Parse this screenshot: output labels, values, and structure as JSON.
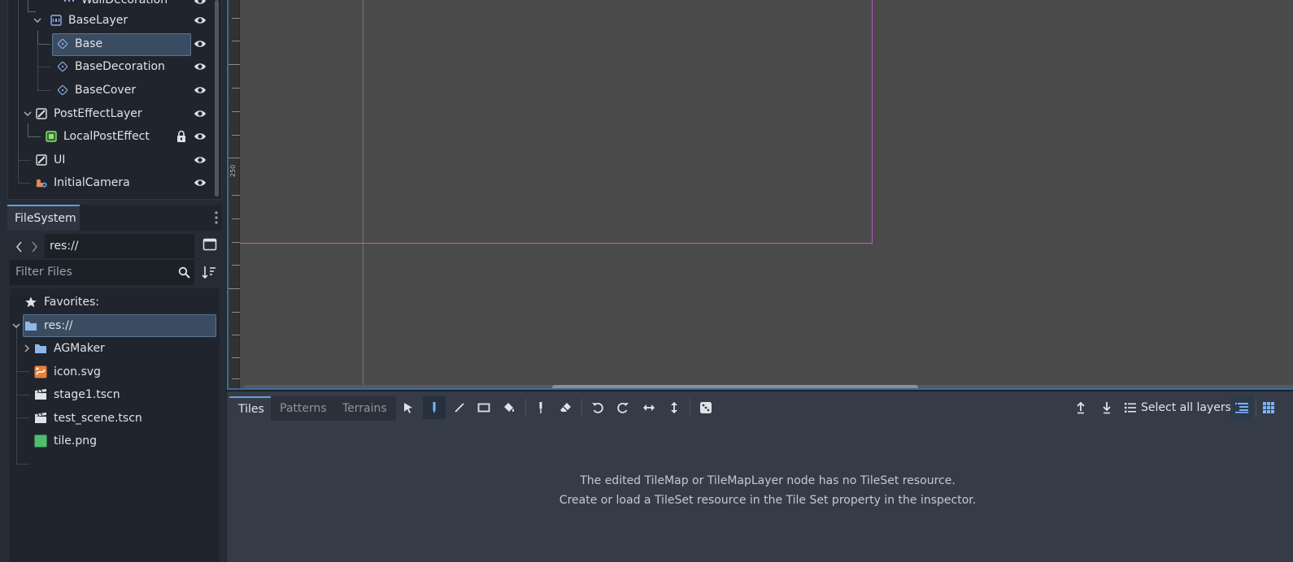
{
  "scene_tree": {
    "items": [
      {
        "label": "WallDecoration",
        "icon": "tilemap-layer-icon"
      },
      {
        "label": "BaseLayer",
        "icon": "parallax-icon"
      },
      {
        "label": "Base",
        "icon": "tilemap-layer-icon",
        "selected": true
      },
      {
        "label": "BaseDecoration",
        "icon": "tilemap-layer-icon"
      },
      {
        "label": "BaseCover",
        "icon": "tilemap-layer-icon"
      },
      {
        "label": "PostEffectLayer",
        "icon": "canvas-layer-icon"
      },
      {
        "label": "LocalPostEffect",
        "icon": "color-rect-icon",
        "locked": true
      },
      {
        "label": "UI",
        "icon": "canvas-layer-icon"
      },
      {
        "label": "InitialCamera",
        "icon": "camera-icon"
      }
    ]
  },
  "filesystem": {
    "tab_label": "FileSystem",
    "path": "res://",
    "filter_placeholder": "Filter Files",
    "favorites_label": "Favorites:",
    "root_label": "res://",
    "items": [
      {
        "label": "AGMaker",
        "icon": "folder-icon"
      },
      {
        "label": "icon.svg",
        "icon": "svg-file-icon"
      },
      {
        "label": "stage1.tscn",
        "icon": "scene-file-icon"
      },
      {
        "label": "test_scene.tscn",
        "icon": "scene-file-icon"
      },
      {
        "label": "tile.png",
        "icon": "image-file-icon"
      }
    ]
  },
  "viewport": {
    "ruler_label": "250"
  },
  "tilemap_panel": {
    "tabs": [
      "Tiles",
      "Patterns",
      "Terrains"
    ],
    "active_tab": "Tiles",
    "select_layers_label": "Select all layers",
    "message_line1": "The edited TileMap or TileMapLayer node has no TileSet resource.",
    "message_line2": "Create or load a TileSet resource in the Tile Set property in the inspector."
  },
  "colors": {
    "accent": "#6c9bd5",
    "selection": "#3a4c61",
    "frame": "#c05ac9",
    "y_axis": "#6ea35c"
  }
}
